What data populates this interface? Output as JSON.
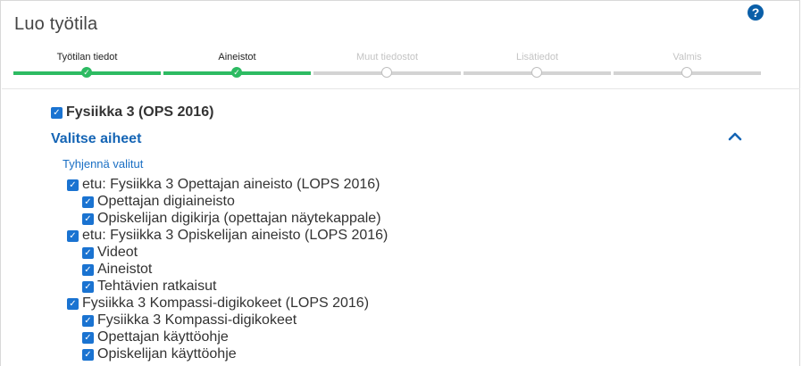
{
  "header": {
    "title": "Luo työtila",
    "help_icon": "help-icon"
  },
  "steps": [
    {
      "label": "Työtilan tiedot",
      "state": "done"
    },
    {
      "label": "Aineistot",
      "state": "done"
    },
    {
      "label": "Muut tiedostot",
      "state": "todo"
    },
    {
      "label": "Lisätiedot",
      "state": "todo"
    },
    {
      "label": "Valmis",
      "state": "todo"
    }
  ],
  "content": {
    "book_label": "Fysiikka 3 (OPS 2016)",
    "book_checked": true,
    "section_title": "Valitse aiheet",
    "clear_label": "Tyhjennä valitut",
    "groups": [
      {
        "label": "etu: Fysiikka 3 Opettajan aineisto (LOPS 2016)",
        "checked": true,
        "items": [
          "Opettajan digiaineisto",
          "Opiskelijan digikirja (opettajan näytekappale)"
        ]
      },
      {
        "label": "etu: Fysiikka 3 Opiskelijan aineisto (LOPS 2016)",
        "checked": true,
        "items": [
          "Videot",
          "Aineistot",
          "Tehtävien ratkaisut"
        ]
      },
      {
        "label": "Fysiikka 3 Kompassi-digikokeet (LOPS 2016)",
        "checked": true,
        "items": [
          "Fysiikka 3 Kompassi-digikokeet",
          "Opettajan käyttöohje",
          "Opiskelijan käyttöohje"
        ]
      }
    ]
  },
  "colors": {
    "accent": "#1a73d1",
    "done": "#2dbb62",
    "link": "#1565b5"
  }
}
